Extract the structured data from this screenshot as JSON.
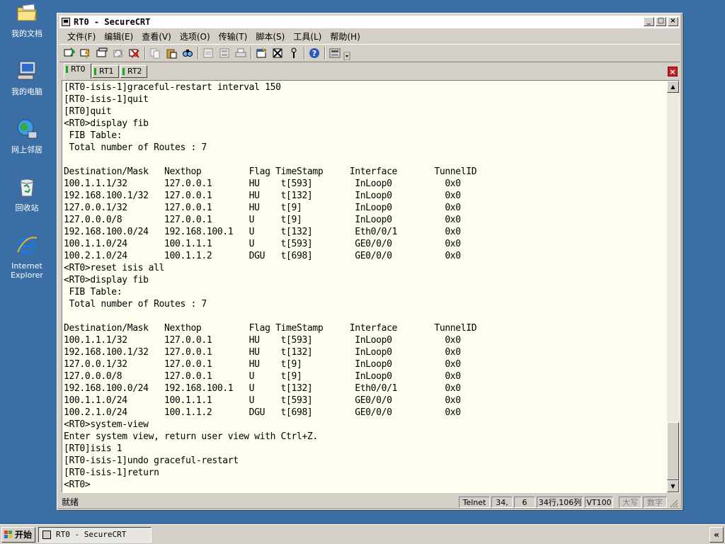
{
  "desktop": {
    "icons": [
      {
        "label": "我的文档"
      },
      {
        "label": "我的电脑"
      },
      {
        "label": "网上邻居"
      },
      {
        "label": "回收站"
      },
      {
        "label": "Internet Explorer"
      }
    ]
  },
  "window": {
    "title": "RT0 - SecureCRT",
    "menu": [
      "文件(F)",
      "编辑(E)",
      "查看(V)",
      "选项(O)",
      "传输(T)",
      "脚本(S)",
      "工具(L)",
      "帮助(H)"
    ],
    "tabs": [
      {
        "label": "RT0",
        "active": true
      },
      {
        "label": "RT1",
        "active": false
      },
      {
        "label": "RT2",
        "active": false
      }
    ],
    "tab_close": "×"
  },
  "terminal": {
    "lines": [
      "[RT0-isis-1]graceful-restart interval 150",
      "[RT0-isis-1]quit",
      "[RT0]quit",
      "<RT0>display fib",
      " FIB Table:",
      " Total number of Routes : 7",
      "",
      "Destination/Mask   Nexthop         Flag TimeStamp     Interface       TunnelID",
      "100.1.1.1/32       127.0.0.1       HU    t[593]        InLoop0          0x0",
      "192.168.100.1/32   127.0.0.1       HU    t[132]        InLoop0          0x0",
      "127.0.0.1/32       127.0.0.1       HU    t[9]          InLoop0          0x0",
      "127.0.0.0/8        127.0.0.1       U     t[9]          InLoop0          0x0",
      "192.168.100.0/24   192.168.100.1   U     t[132]        Eth0/0/1         0x0",
      "100.1.1.0/24       100.1.1.1       U     t[593]        GE0/0/0          0x0",
      "100.2.1.0/24       100.1.1.2       DGU   t[698]        GE0/0/0          0x0",
      "<RT0>reset isis all",
      "<RT0>display fib",
      " FIB Table:",
      " Total number of Routes : 7",
      "",
      "Destination/Mask   Nexthop         Flag TimeStamp     Interface       TunnelID",
      "100.1.1.1/32       127.0.0.1       HU    t[593]        InLoop0          0x0",
      "192.168.100.1/32   127.0.0.1       HU    t[132]        InLoop0          0x0",
      "127.0.0.1/32       127.0.0.1       HU    t[9]          InLoop0          0x0",
      "127.0.0.0/8        127.0.0.1       U     t[9]          InLoop0          0x0",
      "192.168.100.0/24   192.168.100.1   U     t[132]        Eth0/0/1         0x0",
      "100.1.1.0/24       100.1.1.1       U     t[593]        GE0/0/0          0x0",
      "100.2.1.0/24       100.1.1.2       DGU   t[698]        GE0/0/0          0x0",
      "<RT0>system-view",
      "Enter system view, return user view with Ctrl+Z.",
      "[RT0]isis 1",
      "[RT0-isis-1]undo graceful-restart",
      "[RT0-isis-1]return",
      "<RT0>"
    ]
  },
  "statusbar": {
    "ready": "就绪",
    "protocol": "Telnet",
    "row": "34,",
    "col": "6",
    "size": "34行,106列",
    "emulation": "VT100",
    "caps": "大写",
    "num": "数字"
  },
  "taskbar": {
    "start_label": "开始",
    "task_label": "RT0 - SecureCRT",
    "tray_label": "«"
  }
}
